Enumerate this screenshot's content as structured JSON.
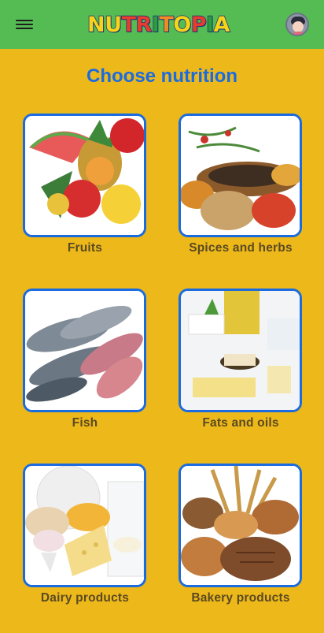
{
  "appbar": {
    "logo_letters": [
      {
        "ch": "N",
        "color": "#F7D417"
      },
      {
        "ch": "U",
        "color": "#F7D417"
      },
      {
        "ch": "T",
        "color": "#E43C2F"
      },
      {
        "ch": "R",
        "color": "#E43C2F"
      },
      {
        "ch": "I",
        "color": "#2D9C3C"
      },
      {
        "ch": "T",
        "color": "#F08A24"
      },
      {
        "ch": "O",
        "color": "#F7D417"
      },
      {
        "ch": "P",
        "color": "#E43C2F"
      },
      {
        "ch": "I",
        "color": "#2D9C3C"
      },
      {
        "ch": "A",
        "color": "#F7D417"
      }
    ],
    "menu_icon": "hamburger-menu-icon",
    "avatar_icon": "user-avatar-icon"
  },
  "page": {
    "title": "Choose nutrition"
  },
  "categories": [
    {
      "label": "Fruits",
      "icon": "fruits-image"
    },
    {
      "label": "Spices and herbs",
      "icon": "spices-image"
    },
    {
      "label": "Fish",
      "icon": "fish-image"
    },
    {
      "label": "Fats and oils",
      "icon": "fats-oils-image"
    },
    {
      "label": "Dairy products",
      "icon": "dairy-image"
    },
    {
      "label": "Bakery products",
      "icon": "bakery-image"
    }
  ],
  "colors": {
    "appbar": "#55BC54",
    "background": "#EDB81A",
    "accent": "#1A6BE0",
    "label": "#5a4a22"
  }
}
